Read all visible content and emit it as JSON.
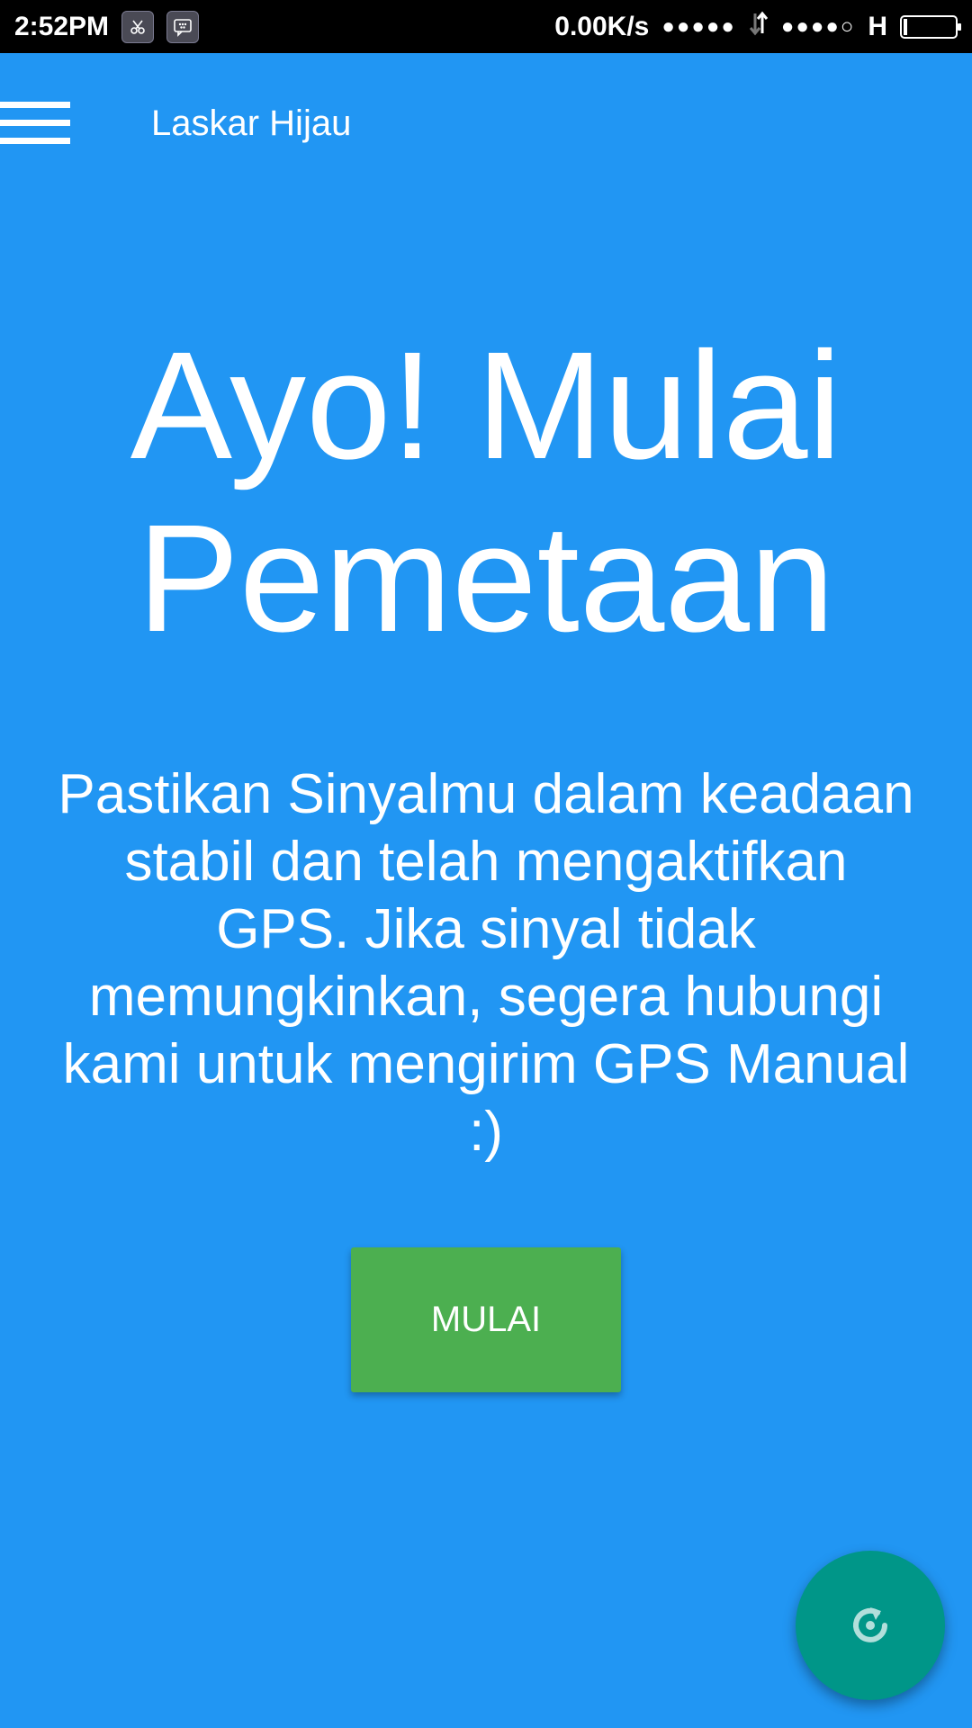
{
  "status_bar": {
    "time": "2:52PM",
    "network_speed": "0.00K/s",
    "signal1": "●●●●●",
    "signal2": "●●●●○",
    "network_type": "H",
    "battery_level": 0.08
  },
  "app_bar": {
    "title": "Laskar Hijau",
    "menu_icon": "hamburger-menu-icon"
  },
  "hero": {
    "title": "Ayo! Mulai Pemetaan",
    "description": "Pastikan Sinyalmu dalam keadaan stabil dan telah mengaktifkan GPS. Jika sinyal tidak memungkinkan, segera hubungi kami untuk mengirim GPS Manual :)"
  },
  "start_button": {
    "label": "MULAI"
  },
  "fab": {
    "icon": "refresh-icon"
  },
  "colors": {
    "background": "#2196F3",
    "button": "#4CAF50",
    "fab": "#009688",
    "status_bar": "#000000"
  }
}
